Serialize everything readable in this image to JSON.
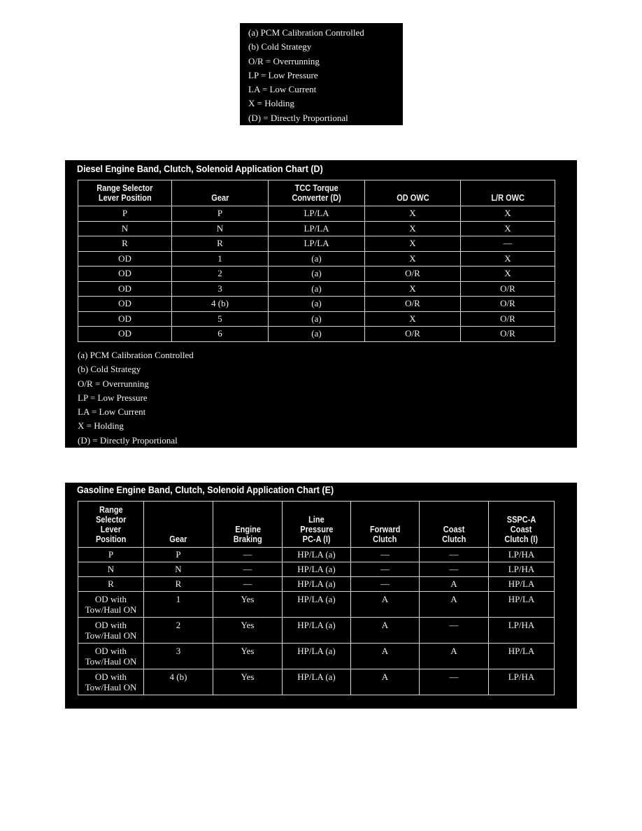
{
  "legend_top": [
    "(a) PCM Calibration Controlled",
    "(b) Cold Strategy",
    "O/R = Overrunning",
    "LP = Low Pressure",
    "LA = Low Current",
    "X = Holding",
    "(D) = Directly Proportional"
  ],
  "diesel": {
    "title": "Diesel Engine Band, Clutch, Solenoid Application Chart (D)",
    "headers": [
      [
        "Range Selector",
        "Lever Position"
      ],
      [
        "Gear"
      ],
      [
        "TCC Torque",
        "Converter (D)"
      ],
      [
        "OD OWC"
      ],
      [
        "L/R OWC"
      ]
    ],
    "rows": [
      [
        "P",
        "P",
        "LP/LA",
        "X",
        "X"
      ],
      [
        "N",
        "N",
        "LP/LA",
        "X",
        "X"
      ],
      [
        "R",
        "R",
        "LP/LA",
        "X",
        "—"
      ],
      [
        "OD",
        "1",
        "(a)",
        "X",
        "X"
      ],
      [
        "OD",
        "2",
        "(a)",
        "O/R",
        "X"
      ],
      [
        "OD",
        "3",
        "(a)",
        "X",
        "O/R"
      ],
      [
        "OD",
        "4 (b)",
        "(a)",
        "O/R",
        "O/R"
      ],
      [
        "OD",
        "5",
        "(a)",
        "X",
        "O/R"
      ],
      [
        "OD",
        "6",
        "(a)",
        "O/R",
        "O/R"
      ]
    ],
    "legend": [
      "(a) PCM Calibration Controlled",
      "(b) Cold Strategy",
      "O/R = Overrunning",
      "LP = Low Pressure",
      "LA = Low Current",
      "X = Holding",
      "(D) = Directly Proportional"
    ]
  },
  "gasoline": {
    "title": "Gasoline Engine Band, Clutch, Solenoid Application Chart (E)",
    "headers": [
      [
        "Range",
        "Selector",
        "Lever",
        "Position"
      ],
      [
        "Gear"
      ],
      [
        "Engine",
        "Braking"
      ],
      [
        "Line",
        "Pressure",
        "PC-A (I)"
      ],
      [
        "Forward",
        "Clutch"
      ],
      [
        "Coast",
        "Clutch"
      ],
      [
        "SSPC-A",
        "Coast",
        "Clutch (I)"
      ]
    ],
    "rows": [
      [
        [
          "P"
        ],
        [
          "P"
        ],
        [
          "—"
        ],
        [
          "HP/LA (a)"
        ],
        [
          "—"
        ],
        [
          "—"
        ],
        [
          "LP/HA"
        ]
      ],
      [
        [
          "N"
        ],
        [
          "N"
        ],
        [
          "—"
        ],
        [
          "HP/LA (a)"
        ],
        [
          "—"
        ],
        [
          "—"
        ],
        [
          "LP/HA"
        ]
      ],
      [
        [
          "R"
        ],
        [
          "R"
        ],
        [
          "—"
        ],
        [
          "HP/LA (a)"
        ],
        [
          "—"
        ],
        [
          "A"
        ],
        [
          "HP/LA"
        ]
      ],
      [
        [
          "OD with",
          "Tow/Haul ON"
        ],
        [
          "1"
        ],
        [
          "Yes"
        ],
        [
          "HP/LA (a)"
        ],
        [
          "A"
        ],
        [
          "A"
        ],
        [
          "HP/LA"
        ]
      ],
      [
        [
          "OD with",
          "Tow/Haul ON"
        ],
        [
          "2"
        ],
        [
          "Yes"
        ],
        [
          "HP/LA (a)"
        ],
        [
          "A"
        ],
        [
          "—"
        ],
        [
          "LP/HA"
        ]
      ],
      [
        [
          "OD with",
          "Tow/Haul ON"
        ],
        [
          "3"
        ],
        [
          "Yes"
        ],
        [
          "HP/LA (a)"
        ],
        [
          "A"
        ],
        [
          "A"
        ],
        [
          "HP/LA"
        ]
      ],
      [
        [
          "OD with",
          "Tow/Haul ON"
        ],
        [
          "4 (b)"
        ],
        [
          "Yes"
        ],
        [
          "HP/LA (a)"
        ],
        [
          "A"
        ],
        [
          "—"
        ],
        [
          "LP/HA"
        ]
      ]
    ]
  }
}
